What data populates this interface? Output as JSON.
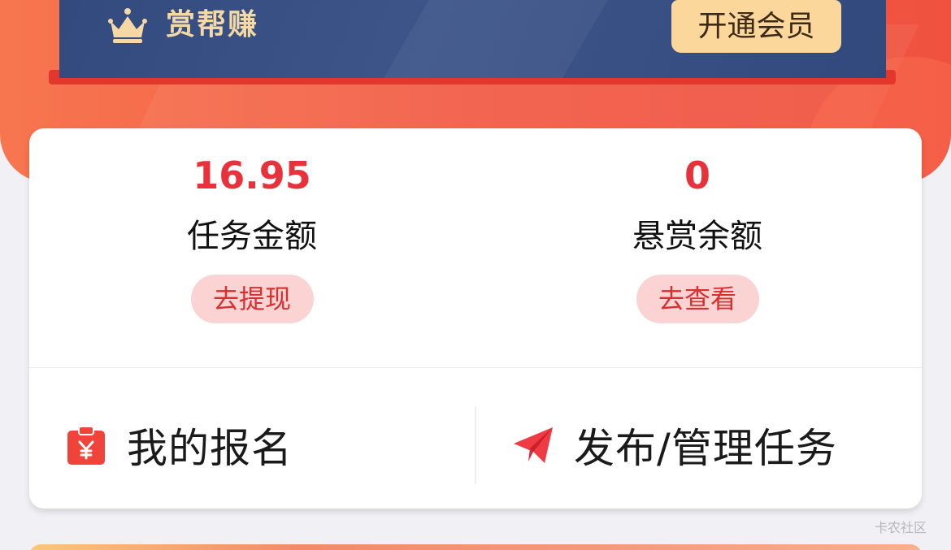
{
  "vip": {
    "brand": "赏帮赚",
    "open_button": "开通会员"
  },
  "stats": [
    {
      "value": "16.95",
      "label": "任务金额",
      "action": "去提现"
    },
    {
      "value": "0",
      "label": "悬赏余额",
      "action": "去查看"
    }
  ],
  "actions": {
    "my_signup": "我的报名",
    "publish_manage": "发布/管理任务"
  },
  "watermark": "卡农社区",
  "colors": {
    "accent_red": "#e8323b",
    "header_red": "#f25c47",
    "vip_navy": "#3d5589",
    "vip_gold": "#fcd79b"
  }
}
